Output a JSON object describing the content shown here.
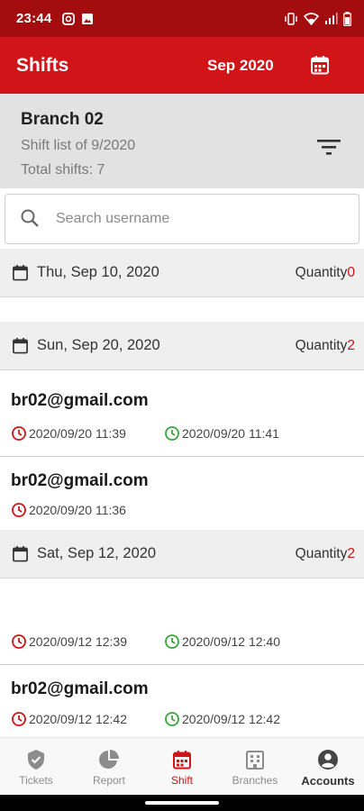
{
  "status_bar": {
    "time": "23:44"
  },
  "app_bar": {
    "title": "Shifts",
    "month": "Sep 2020"
  },
  "branch": {
    "name": "Branch 02",
    "subtitle": "Shift list of 9/2020",
    "total": "Total shifts: 7"
  },
  "search": {
    "placeholder": "Search username",
    "value": ""
  },
  "quantity_label": "Quantity",
  "days": [
    {
      "date": "Thu, Sep 10, 2020",
      "quantity": "0"
    },
    {
      "date": "Sun, Sep 20, 2020",
      "quantity": "2"
    },
    {
      "date": "Sat, Sep 12, 2020",
      "quantity": "2"
    }
  ],
  "shifts": [
    {
      "user": "br02@gmail.com",
      "check_in": "2020/09/20 11:39",
      "check_out": "2020/09/20 11:41"
    },
    {
      "user": "br02@gmail.com",
      "check_in": "2020/09/20 11:36"
    },
    {
      "user": "",
      "check_in": "2020/09/12 12:39",
      "check_out": "2020/09/12 12:40"
    },
    {
      "user": "br02@gmail.com",
      "check_in": "2020/09/12 12:42",
      "check_out": "2020/09/12 12:42"
    }
  ],
  "bottom_nav": [
    {
      "label": "Tickets",
      "icon": "shield-check-icon"
    },
    {
      "label": "Report",
      "icon": "pie-chart-icon"
    },
    {
      "label": "Shift",
      "icon": "calendar-icon",
      "active": true
    },
    {
      "label": "Branches",
      "icon": "building-icon"
    },
    {
      "label": "Accounts",
      "icon": "account-icon"
    }
  ],
  "colors": {
    "primary": "#d01417",
    "status_bar": "#a30d10",
    "check_in": "#d01417",
    "check_out": "#3aa53a"
  }
}
